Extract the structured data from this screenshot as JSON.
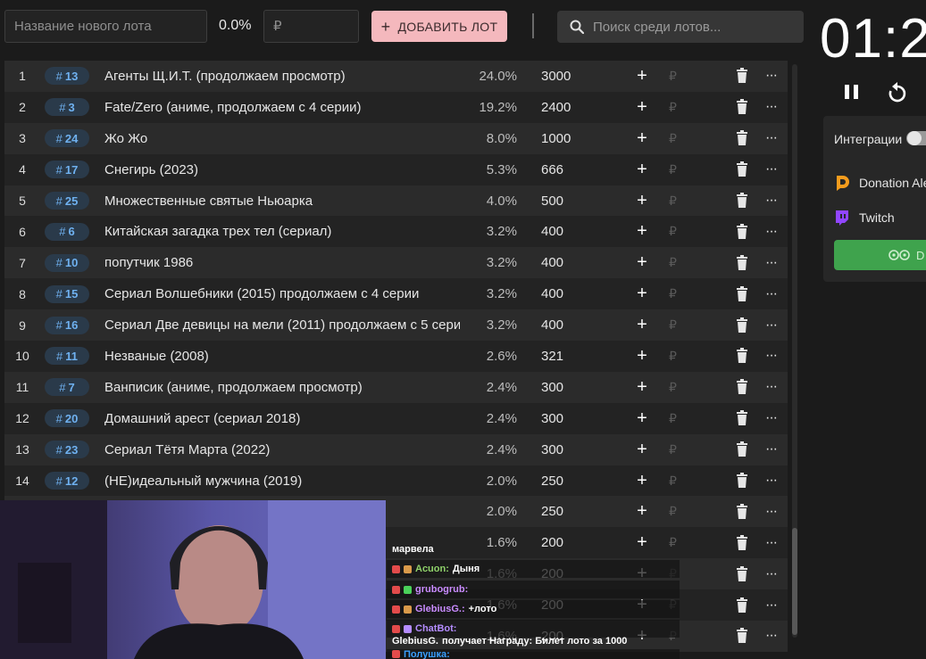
{
  "header": {
    "name_placeholder": "Название нового лота",
    "percent": "0.0%",
    "amount_placeholder": "₽",
    "add_label": "ДОБАВИТЬ ЛОТ",
    "search_placeholder": "Поиск среди лотов..."
  },
  "lots": [
    {
      "idx": "1",
      "id": "13",
      "name": "Агенты Щ.И.Т. (продолжаем просмотр)",
      "pct": "24.0%",
      "amount": "3000"
    },
    {
      "idx": "2",
      "id": "3",
      "name": "Fate/Zero (аниме, продолжаем с 4 серии)",
      "pct": "19.2%",
      "amount": "2400"
    },
    {
      "idx": "3",
      "id": "24",
      "name": "Жо Жо",
      "pct": "8.0%",
      "amount": "1000"
    },
    {
      "idx": "4",
      "id": "17",
      "name": "Снегирь (2023)",
      "pct": "5.3%",
      "amount": "666"
    },
    {
      "idx": "5",
      "id": "25",
      "name": "Множественные святые Ньюарка",
      "pct": "4.0%",
      "amount": "500"
    },
    {
      "idx": "6",
      "id": "6",
      "name": "Китайская загадка трех тел (сериал)",
      "pct": "3.2%",
      "amount": "400"
    },
    {
      "idx": "7",
      "id": "10",
      "name": "попутчик 1986",
      "pct": "3.2%",
      "amount": "400"
    },
    {
      "idx": "8",
      "id": "15",
      "name": "Сериал Волшебники (2015) продолжаем с 4 серии",
      "pct": "3.2%",
      "amount": "400"
    },
    {
      "idx": "9",
      "id": "16",
      "name": "Сериал Две девицы на мели (2011) продолжаем с 5 сери",
      "pct": "3.2%",
      "amount": "400"
    },
    {
      "idx": "10",
      "id": "11",
      "name": "Незваные (2008)",
      "pct": "2.6%",
      "amount": "321"
    },
    {
      "idx": "11",
      "id": "7",
      "name": "Ванписик (аниме, продолжаем просмотр)",
      "pct": "2.4%",
      "amount": "300"
    },
    {
      "idx": "12",
      "id": "20",
      "name": "Домашний арест (сериал 2018)",
      "pct": "2.4%",
      "amount": "300"
    },
    {
      "idx": "13",
      "id": "23",
      "name": "Сериал Тётя Марта (2022)",
      "pct": "2.4%",
      "amount": "300"
    },
    {
      "idx": "14",
      "id": "12",
      "name": "(НЕ)идеальный мужчина (2019)",
      "pct": "2.0%",
      "amount": "250"
    },
    {
      "idx": "",
      "id": "",
      "name": "",
      "pct": "2.0%",
      "amount": "250"
    },
    {
      "idx": "",
      "id": "",
      "name": "",
      "pct": "1.6%",
      "amount": "200"
    },
    {
      "idx": "",
      "id": "",
      "name": "",
      "pct": "1.6%",
      "amount": "200"
    },
    {
      "idx": "",
      "id": "",
      "name": "",
      "pct": "1.6%",
      "amount": "200"
    },
    {
      "idx": "",
      "id": "",
      "name": "",
      "pct": "1.6%",
      "amount": "200"
    }
  ],
  "row_controls": {
    "plus": "+",
    "rub": "₽",
    "more": "···",
    "hash": "#"
  },
  "timer": {
    "time": "01:2"
  },
  "integrations": {
    "label": "Интеграции",
    "services": [
      {
        "name": "Donation Ale",
        "color": "#f59c1d"
      },
      {
        "name": "Twitch",
        "color": "#9146ff"
      }
    ],
    "button_label": "D"
  },
  "chat": {
    "title": "марвела",
    "lines": [
      {
        "user": "Acuon:",
        "user_color": "#8fd16a",
        "text": "Дыня"
      },
      {
        "user": "grubogrub:",
        "user_color": "#c98bff",
        "text": ""
      },
      {
        "user": "GlebiusG.:",
        "user_color": "#c98bff",
        "text": "+лото"
      },
      {
        "user": "ChatBot:",
        "user_color": "#b48cff",
        "text": ""
      },
      {
        "user": "GlebiusG.",
        "user_color": "#ffffff",
        "text": "получает Награду: Билет лото за 1000"
      },
      {
        "user": "Полушка:",
        "user_color": "#3aa0ff",
        "text": ""
      }
    ]
  },
  "colors": {
    "accent_pink": "#f4b8bd",
    "id_blue": "#6fb1f0",
    "green": "#3fa34d"
  }
}
